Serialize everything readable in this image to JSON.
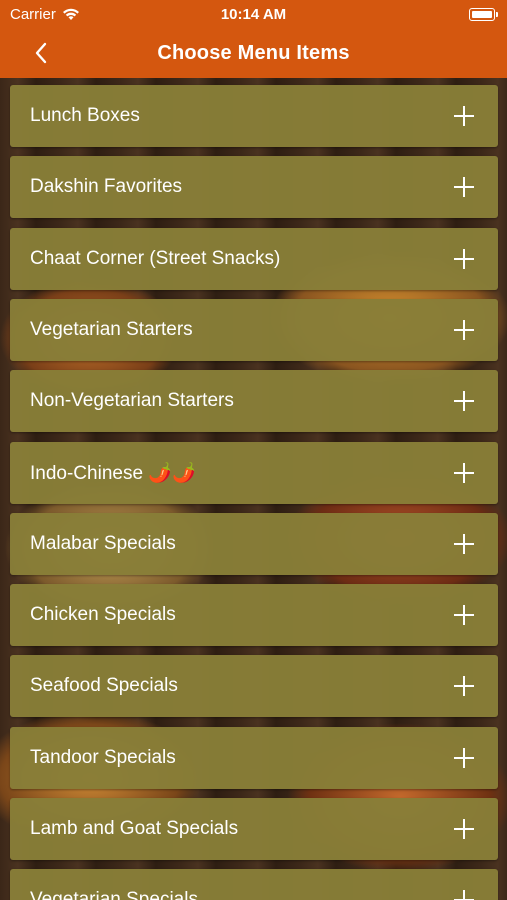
{
  "status_bar": {
    "carrier": "Carrier",
    "time": "10:14 AM"
  },
  "nav": {
    "title": "Choose Menu Items"
  },
  "colors": {
    "header": "#d4570f",
    "item_bg": "#887e38",
    "text": "#ffffff"
  },
  "icons": {
    "back": "chevron-left-icon",
    "expand": "plus-icon",
    "wifi": "wifi-icon",
    "battery": "battery-icon"
  },
  "menu": {
    "items": [
      {
        "label": "Lunch Boxes"
      },
      {
        "label": "Dakshin Favorites"
      },
      {
        "label": "Chaat Corner (Street Snacks)"
      },
      {
        "label": "Vegetarian Starters"
      },
      {
        "label": "Non-Vegetarian Starters"
      },
      {
        "label": "Indo-Chinese 🌶️🌶️"
      },
      {
        "label": "Malabar Specials"
      },
      {
        "label": "Chicken Specials"
      },
      {
        "label": "Seafood Specials"
      },
      {
        "label": "Tandoor Specials"
      },
      {
        "label": "Lamb and Goat Specials"
      },
      {
        "label": "Vegetarian Specials"
      }
    ]
  }
}
